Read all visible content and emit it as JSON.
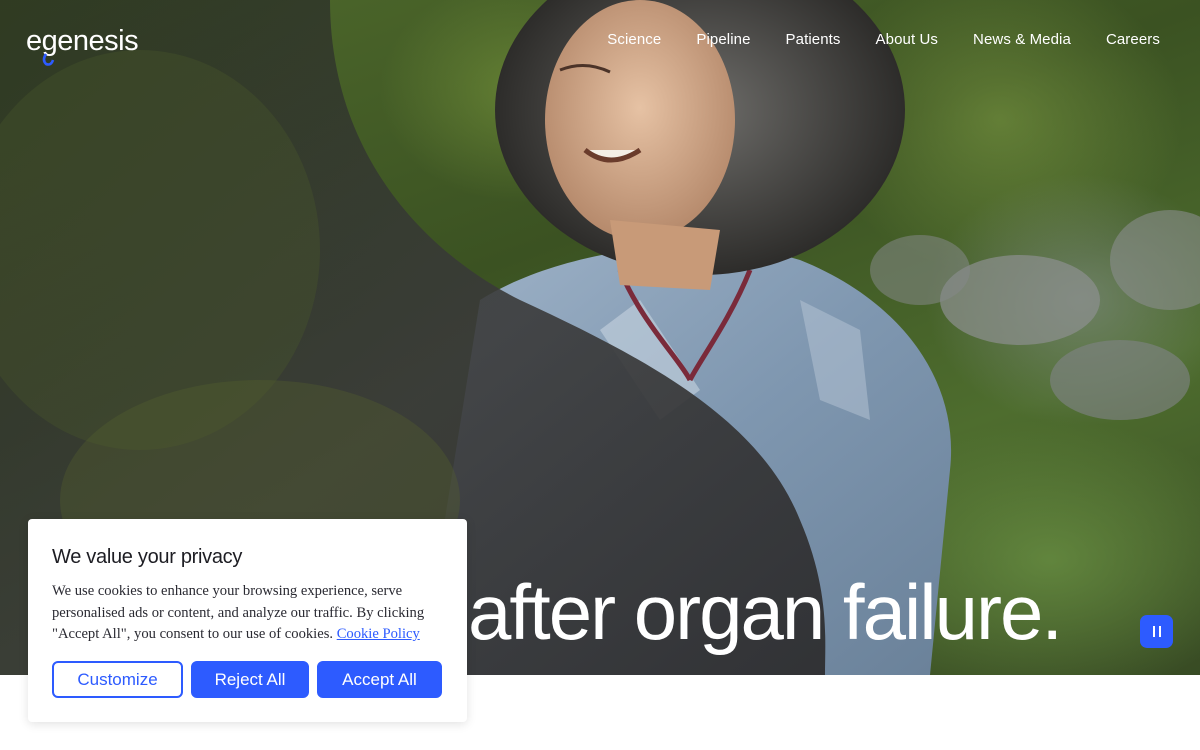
{
  "brand": {
    "name": "egenesis",
    "accent": "#2d5bff"
  },
  "nav": {
    "items": [
      {
        "label": "Science"
      },
      {
        "label": "Pipeline"
      },
      {
        "label": "Patients"
      },
      {
        "label": "About Us"
      },
      {
        "label": "News & Media"
      },
      {
        "label": "Careers"
      }
    ]
  },
  "hero": {
    "headline": "after organ failure.",
    "pause_icon": "pause-icon"
  },
  "cookie": {
    "title": "We value your privacy",
    "body": "We use cookies to enhance your browsing experience, serve personalised ads or content, and analyze our traffic. By clicking \"Accept All\", you consent to our use of cookies.",
    "link_label": "Cookie Policy",
    "customize_label": "Customize",
    "reject_label": "Reject All",
    "accept_label": "Accept All"
  }
}
